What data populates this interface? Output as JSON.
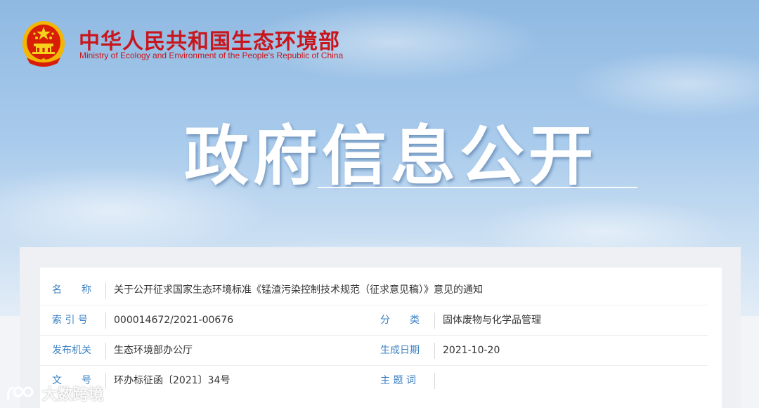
{
  "header": {
    "ministry_name_cn": "中华人民共和国生态环境部",
    "ministry_name_en": "Ministry of Ecology and Environment of the People's Republic of China",
    "banner_title": "政府信息公开"
  },
  "info_table": {
    "name_label": "名　　称",
    "name_value": "关于公开征求国家生态环境标准《锰渣污染控制技术规范（征求意见稿）》意见的通知",
    "index_label": "索 引 号",
    "index_value": "000014672/2021-00676",
    "category_label": "分　　类",
    "category_value": "固体废物与化学品管理",
    "publisher_label": "发布机关",
    "publisher_value": "生态环境部办公厅",
    "date_label": "生成日期",
    "date_value": "2021-10-20",
    "doc_no_label": "文　　号",
    "doc_no_value": "环办标征函〔2021〕34号",
    "keywords_label": "主 题 词",
    "keywords_value": ""
  },
  "watermark": {
    "text": "大数跨境"
  },
  "colors": {
    "brand_red": "#c8161d",
    "label_blue": "#3d82c4",
    "value_text": "#333333"
  }
}
